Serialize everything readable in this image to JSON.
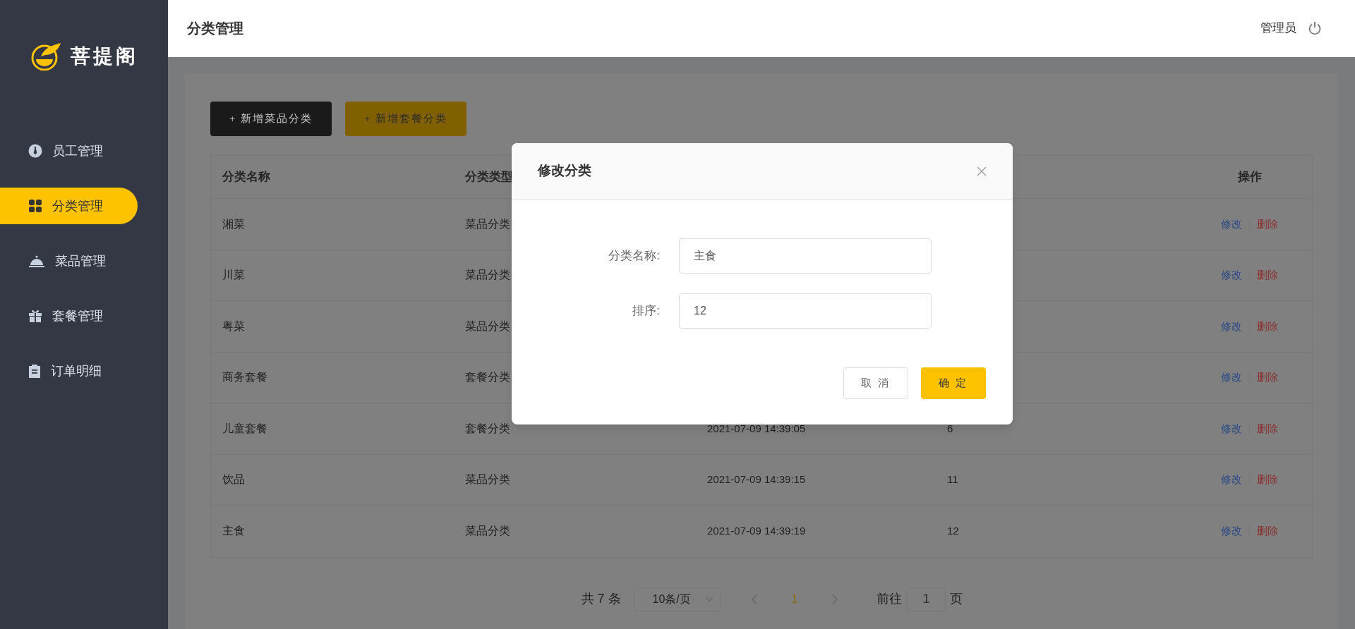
{
  "sidebar": {
    "logo_text": "菩提阁",
    "items": [
      {
        "label": "员工管理",
        "selected": false
      },
      {
        "label": "分类管理",
        "selected": true
      },
      {
        "label": "菜品管理",
        "selected": false
      },
      {
        "label": "套餐管理",
        "selected": false
      },
      {
        "label": "订单明细",
        "selected": false
      }
    ]
  },
  "header": {
    "title": "分类管理",
    "user": "管理员"
  },
  "toolbar": {
    "buttons": [
      {
        "label": "+ 新增菜品分类",
        "kind": "dark"
      },
      {
        "label": "+ 新增套餐分类",
        "kind": "accent"
      }
    ]
  },
  "table": {
    "columns": [
      "分类名称",
      "分类类型",
      "操作"
    ],
    "rows": [
      {
        "name": "湘菜",
        "type": "菜品分类",
        "actions": [
          "修改",
          "删除"
        ]
      },
      {
        "name": "川菜",
        "type": "菜品分类",
        "actions": [
          "修改",
          "删除"
        ]
      },
      {
        "name": "粤菜",
        "type": "菜品分类",
        "actions": [
          "修改",
          "删除"
        ]
      },
      {
        "name": "商务套餐",
        "type": "套餐分类",
        "actions": [
          "修改",
          "删除"
        ]
      },
      {
        "name": "儿童套餐",
        "type": "套餐分类",
        "time": "2021-07-09 14:39:05",
        "sort": "6",
        "actions": [
          "修改",
          "删除"
        ]
      },
      {
        "name": "饮品",
        "type": "菜品分类",
        "time": "2021-07-09 14:39:15",
        "sort": "11",
        "actions": [
          "修改",
          "删除"
        ]
      },
      {
        "name": "主食",
        "type": "菜品分类",
        "time": "2021-07-09 14:39:19",
        "sort": "12",
        "actions": [
          "修改",
          "删除"
        ]
      }
    ]
  },
  "pagination": {
    "total": "共 7 条",
    "page_size": "10条/页",
    "pages": [
      {
        "label": "1",
        "selected": true
      }
    ],
    "goto_label": "前往",
    "goto_value": "1",
    "goto_suffix": "页"
  },
  "dialog": {
    "title": "修改分类",
    "fields": [
      {
        "label": "分类名称:",
        "value": "主食"
      },
      {
        "label": "排序:",
        "value": "12"
      }
    ],
    "buttons": [
      {
        "label": "取 消",
        "kind": "plain"
      },
      {
        "label": "确 定",
        "kind": "primary"
      }
    ]
  }
}
